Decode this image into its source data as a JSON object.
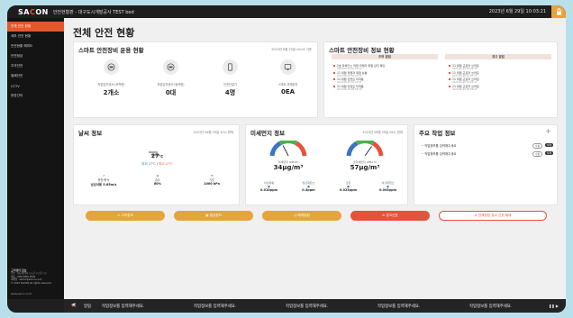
{
  "topbar": {
    "logo_prefix": "SA",
    "logo_accent": "C",
    "logo_suffix": "ON",
    "site_title": "안전현황판 - 대구도시개발공사 TEST bed",
    "datetime": "2023년 6월 29일 10:03:21"
  },
  "sidebar": {
    "items": [
      {
        "label": "전체 안전 현황",
        "active": true
      },
      {
        "label": "세부 안전 현황",
        "active": false
      },
      {
        "label": "안전현황 해피도",
        "active": false
      },
      {
        "label": "안전점검",
        "active": false
      },
      {
        "label": "주의안전",
        "active": false
      },
      {
        "label": "밀폐안전",
        "active": false
      },
      {
        "label": "CCTV",
        "active": false
      },
      {
        "label": "현장관리",
        "active": false
      }
    ],
    "footer_title": "고객센터 정보",
    "footer_lines": [
      "주소 : 대구광역시 ○○구 ○○로 ○○",
      "대표 : 000-0000-0000",
      "이메일 : sacon@sacon.co.kr",
      "© 2023 SACON All rights reserved."
    ],
    "footer_brand": "www.sacon.co.kr"
  },
  "page_title": "전체 안전 현황",
  "smart_equipment": {
    "title": "스마트 안전장비 운용 현황",
    "meta": "2023년 6월 29일 10:03 기준",
    "stats": [
      {
        "label": "작업감지센서 (모학형)",
        "value": "2개소"
      },
      {
        "label": "작업감지센서 (동작형)",
        "value": "0대"
      },
      {
        "label": "안전단말기",
        "value": "4명"
      },
      {
        "label": "스마트 관제장치",
        "value": "0EA"
      }
    ]
  },
  "smart_info": {
    "title": "스마트 안전장비 정보 현황",
    "col_caution": "주의 알림",
    "col_warning": "경고 알림",
    "caution_items": [
      {
        "text": "2호 유해가스 작업 작업자 위험 감지 확인",
        "time": "2023-06-29 10:02:01"
      },
      {
        "text": "11 위험 작업자 위험 상황",
        "time": "2023-06-29 10:01:52"
      },
      {
        "text": "11 위험 안전모 미착용",
        "time": "2023-06-29 10:00:41"
      },
      {
        "text": "11 위험 안전모 미착용",
        "time": "2023-06-29 09:58:30"
      }
    ],
    "warning_items": [
      {
        "text": "11 위험 근로자 쓰러짐",
        "time": "2023-06-29 10:02:18"
      },
      {
        "text": "11 위험 근로자 쓰러짐",
        "time": "2023-06-29 10:01:33"
      },
      {
        "text": "11 위험 근로자 쓰러짐",
        "time": "2023-06-29 10:00:12"
      },
      {
        "text": "11 위험 근로자 쓰러짐",
        "time": "2023-06-29 09:59:47"
      }
    ]
  },
  "weather": {
    "title": "날씨 정보",
    "meta": "2023년 06월 29일 10시 현재",
    "temperature": "27",
    "unit": "℃",
    "range_low": "최저 27℃",
    "range_high": "최고 27℃",
    "wind_label": "풍향/풍속",
    "wind_value": "남남서풍 5.85m/s",
    "humidity_label": "습도",
    "humidity_value": "80%",
    "pressure_label": "기압",
    "pressure_value": "1000 hPa"
  },
  "dust": {
    "title": "미세먼지 정보",
    "meta": "2023년 06월 29일 09시 현재",
    "pm10_label": "미세먼지 (PM10)",
    "pm10_value": "34µg/m³",
    "pm10_level": 0.35,
    "pm25_label": "초미세먼지 (PM2.5)",
    "pm25_value": "57µg/m³",
    "pm25_level": 0.7,
    "gases": [
      {
        "label": "이산화황",
        "value": "0.010ppm"
      },
      {
        "label": "일산화탄소",
        "value": "0.3ppm"
      },
      {
        "label": "오존",
        "value": "0.023ppm"
      },
      {
        "label": "이산화질소",
        "value": "0.003ppm"
      }
    ]
  },
  "work": {
    "title": "주요 작업 정보",
    "add": "+",
    "items": [
      {
        "text": "작업정보를 입력해주세요",
        "edit": "수정",
        "del": "삭제"
      },
      {
        "text": "작업정보를 입력해주세요",
        "edit": "수정",
        "del": "삭제"
      }
    ]
  },
  "buttons": {
    "caution": "⚠ 주의정보",
    "checkup": "▣ 점검정보",
    "alarm": "◷ 해제알림",
    "warning": "⊘ 경고신호",
    "reset": "⊘ 전체현장 경고 신호 해제"
  },
  "bottom": {
    "label_icon": "📢",
    "label": "알림",
    "messages": [
      "작업정보를 입력해주세요.",
      "작업정보를 입력해주세요.",
      "작업정보를 입력해주세요.",
      "작업정보를 입력해주세요.",
      "작업정보를 입력해주세요."
    ],
    "controls": "❚❚ ▶"
  },
  "colors": {
    "accent": "#e25a2b",
    "warning_red": "#e5533d",
    "caution_orange": "#e7a33c"
  }
}
